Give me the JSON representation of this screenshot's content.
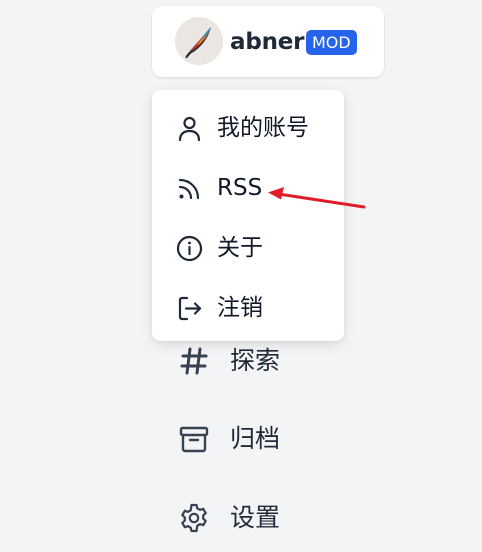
{
  "user": {
    "name": "abner",
    "badge": "MOD"
  },
  "dropdown": {
    "items": [
      {
        "label": "我的账号",
        "icon": "user-icon"
      },
      {
        "label": "RSS",
        "icon": "rss-icon"
      },
      {
        "label": "关于",
        "icon": "info-icon"
      },
      {
        "label": "注销",
        "icon": "logout-icon"
      }
    ]
  },
  "nav": {
    "items": [
      {
        "label": "探索",
        "icon": "hash-icon"
      },
      {
        "label": "归档",
        "icon": "archive-icon"
      },
      {
        "label": "设置",
        "icon": "gear-icon"
      }
    ]
  },
  "colors": {
    "background": "#f3f4f6",
    "badge": "#2563eb",
    "annotation_arrow": "#e11d2a",
    "icon": "#374151"
  }
}
